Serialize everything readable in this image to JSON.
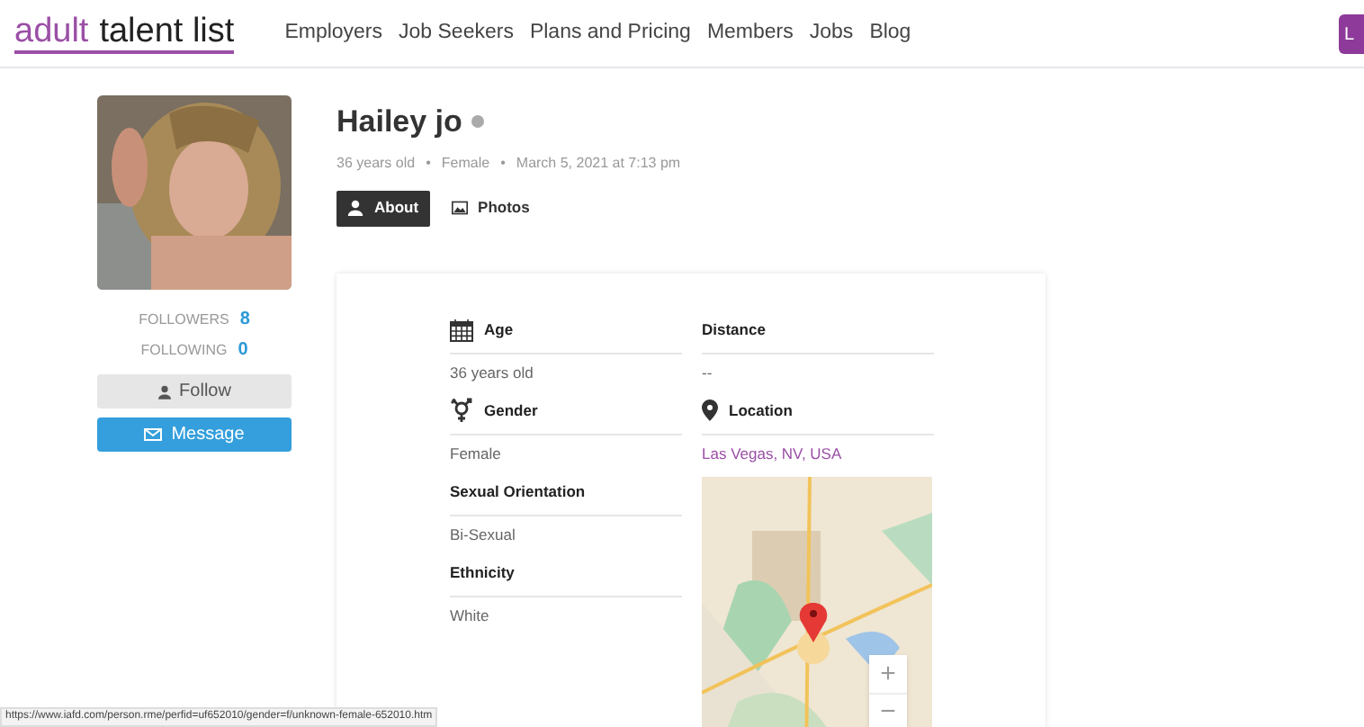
{
  "header": {
    "logo": {
      "part_1": "adult",
      "part_2": "talent list"
    },
    "nav": [
      "Employers",
      "Job Seekers",
      "Plans and Pricing",
      "Members",
      "Jobs",
      "Blog"
    ],
    "login_button": "L"
  },
  "sidebar": {
    "stats": [
      {
        "label": "FOLLOWERS",
        "value": "8"
      },
      {
        "label": "FOLLOWING",
        "value": "0"
      }
    ],
    "follow_button": "Follow",
    "message_button": "Message"
  },
  "profile": {
    "name": "Hailey jo",
    "online": false,
    "meta": [
      "36 years old",
      "•",
      "Female",
      "•",
      "March 5, 2021 at 7:13 pm"
    ]
  },
  "tabs": [
    {
      "label": "About",
      "selected": true
    },
    {
      "label": "Photos",
      "selected": false
    }
  ],
  "details": {
    "left": [
      {
        "label": "Age",
        "value": "36 years old"
      },
      {
        "label": "Gender",
        "value": "Female"
      },
      {
        "label": "Sexual Orientation",
        "value": "Bi-Sexual"
      },
      {
        "label": "Ethnicity",
        "value": "White"
      }
    ],
    "right": [
      {
        "label": "Distance",
        "value": "--"
      },
      {
        "label": "Location",
        "value": "Las Vegas, NV, USA"
      }
    ],
    "map": {
      "zoom_in": "+",
      "zoom_out": "−"
    }
  },
  "status_bar": {
    "url": "https://www.iafd.com/person.rme/perfid=uf652010/gender=f/unknown-female-652010.htm"
  }
}
